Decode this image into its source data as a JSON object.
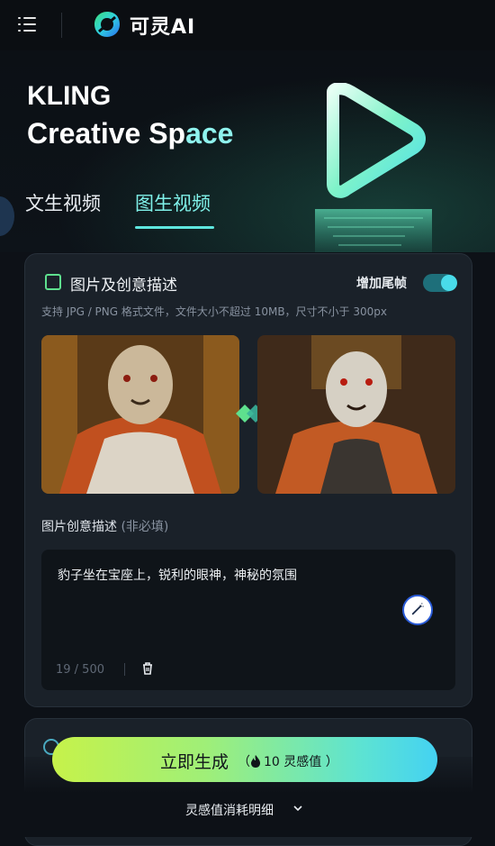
{
  "header": {
    "brand": "可灵AI",
    "menu_icon": "menu-icon",
    "logo_icon": "kling-logo"
  },
  "hero": {
    "title_line1": "KLING",
    "title_line2_a": "Creative Sp",
    "title_line2_b": "ace"
  },
  "tabs": [
    {
      "label": "文生视频"
    },
    {
      "label": "图生视频"
    }
  ],
  "active_tab": "图生视频",
  "card": {
    "title": "图片及创意描述",
    "tail_frame_label": "增加尾帧",
    "tail_frame_enabled": true,
    "upload_hint": "支持 JPG / PNG 格式文件，文件大小不超过 10MB，尺寸不小于 300px",
    "desc_label": "图片创意描述",
    "desc_optional": "(非必填)",
    "prompt_text": "豹子坐在宝座上，锐利的眼神，神秘的氛围",
    "char_count": "19 / 500"
  },
  "generate": {
    "label": "立即生成",
    "cost_prefix": "（",
    "cost_value": "10 灵感值",
    "cost_suffix": " ）"
  },
  "footer": {
    "detail_link": "灵感值消耗明细"
  },
  "colors": {
    "accent": "#5ee6de",
    "toggle": "#49dbe9",
    "card_bg": "#1a2129"
  }
}
